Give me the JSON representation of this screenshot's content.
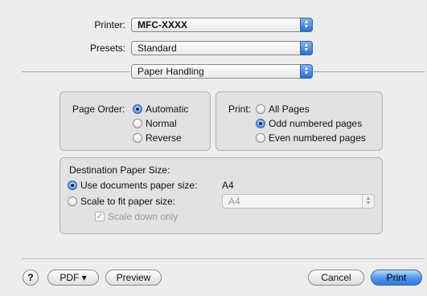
{
  "printer": {
    "label": "Printer:",
    "value": "MFC-XXXX"
  },
  "presets": {
    "label": "Presets:",
    "value": "Standard"
  },
  "panel_select": {
    "value": "Paper Handling"
  },
  "page_order": {
    "label": "Page Order:",
    "options": [
      "Automatic",
      "Normal",
      "Reverse"
    ],
    "selected": "Automatic"
  },
  "print_pages": {
    "label": "Print:",
    "options": [
      "All Pages",
      "Odd numbered pages",
      "Even numbered pages"
    ],
    "selected": "Odd numbered pages"
  },
  "destination": {
    "title": "Destination Paper Size:",
    "use_doc_label": "Use documents paper size:",
    "use_doc_value": "A4",
    "scale_label": "Scale to fit paper size:",
    "scale_value": "A4",
    "scale_down_label": "Scale down only",
    "scale_down_checked": true
  },
  "footer": {
    "help": "?",
    "pdf": "PDF ▾",
    "preview": "Preview",
    "cancel": "Cancel",
    "print": "Print"
  }
}
